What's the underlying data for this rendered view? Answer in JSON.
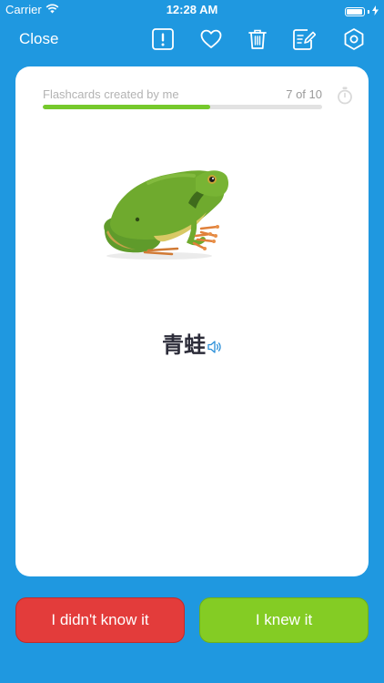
{
  "status_bar": {
    "carrier": "Carrier",
    "time": "12:28 AM"
  },
  "toolbar": {
    "close_label": "Close",
    "icons": [
      "report-icon",
      "heart-icon",
      "trash-icon",
      "edit-icon",
      "settings-icon"
    ]
  },
  "card": {
    "deck_title": "Flashcards created by me",
    "progress_text": "7 of 10",
    "progress_fraction": 0.6,
    "image": "green-tree-frog",
    "word": "青蛙"
  },
  "buttons": {
    "didnt_know": "I didn't know it",
    "knew": "I knew it"
  },
  "colors": {
    "background": "#1f98e0",
    "progress": "#76c92c",
    "didnt_know": "#e33c3b",
    "knew": "#84cc24"
  }
}
